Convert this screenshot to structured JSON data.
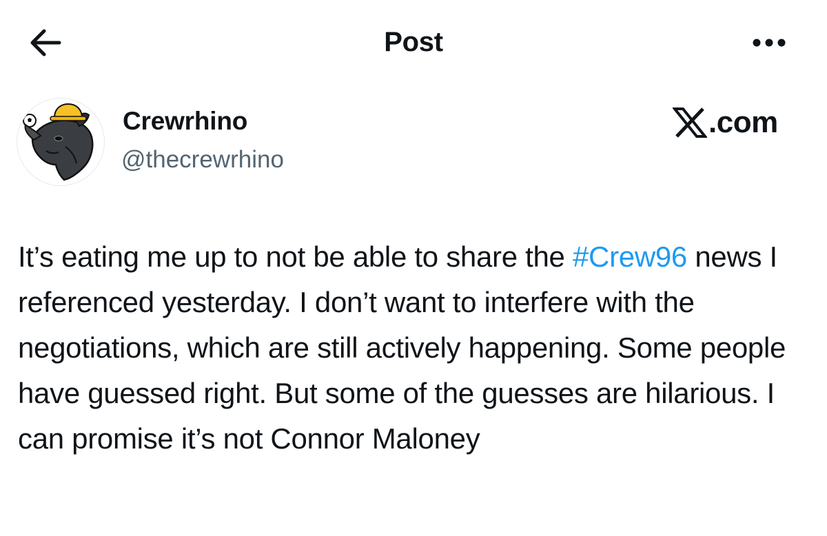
{
  "header": {
    "title": "Post",
    "back_icon": "arrow-left-icon",
    "more_icon": "more-horizontal-icon"
  },
  "author": {
    "display_name": "Crewrhino",
    "handle": "@thecrewrhino",
    "avatar_icon": "rhino-avatar"
  },
  "site": {
    "logo_icon": "x-logo-icon",
    "domain_suffix": ".com"
  },
  "post": {
    "text_before": "It’s eating me up to not be able to share the ",
    "hashtag": "#Crew96",
    "text_after": " news I referenced yesterday. I don’t want to interfere with the negotiations, which are still actively happening. Some people have guessed right. But some of the guesses are hilarious. I can promise it’s not Connor Maloney"
  },
  "colors": {
    "text": "#0f1419",
    "secondary_text": "#536471",
    "link": "#1d9bf0",
    "background": "#ffffff"
  }
}
